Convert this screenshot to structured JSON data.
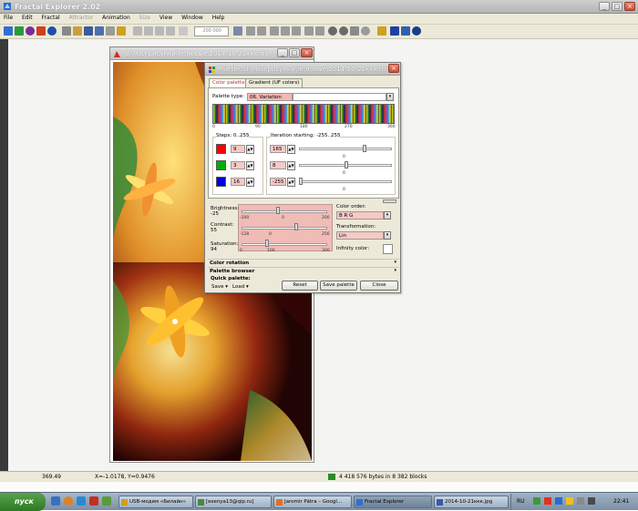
{
  "app": {
    "title": "Fractal Explorer 2.02"
  },
  "menu": [
    "File",
    "Edit",
    "Fractal",
    "Attractor",
    "Animation",
    "Size",
    "View",
    "Window",
    "Help"
  ],
  "toolbar": {
    "zoom_value": "200 000"
  },
  "fractal_window": {
    "title": "d:\\мои рисунки\\fe\\новые\\2014-10-21ккк.frs"
  },
  "palette_dialog": {
    "title": "Palette: d:\\мои рисунки\\fe\\новые\\2014-10-21ккк.frs",
    "tabs": [
      "Color palette",
      "Gradient (UF colors)"
    ],
    "palette_type_label": "Palette type:",
    "palette_type_value": "06. Variation",
    "bar_ticks": [
      "0",
      "90",
      "180",
      "270",
      "360"
    ],
    "steps_label": "Steps: 0..255",
    "iteration_label": "Iteration starting: -255..255",
    "rows": [
      {
        "color": "#ff0000",
        "steps": "9",
        "iter": "165",
        "center": "0"
      },
      {
        "color": "#00b000",
        "steps": "3",
        "iter": "8",
        "center": "0"
      },
      {
        "color": "#0000e0",
        "steps": "16",
        "iter": "-255",
        "center": "0"
      }
    ],
    "brightness": {
      "label": "Brightness:",
      "value": "-25",
      "ticks": [
        "-200",
        "0",
        "200"
      ]
    },
    "contrast": {
      "label": "Contrast:",
      "value": "55",
      "ticks": [
        "-128",
        "0",
        "256"
      ]
    },
    "saturation": {
      "label": "Saturation:",
      "value": "94",
      "ticks": [
        "0",
        "100",
        "300"
      ]
    },
    "color_order": {
      "label": "Color order:",
      "value": "B R G"
    },
    "transformation": {
      "label": "Transformation:",
      "value": "Lin"
    },
    "infinity_label": "Infinity color:",
    "color_rotation": "Color rotation",
    "palette_browser": "Palette browser",
    "quick_palette": "Quick palette:",
    "save_label": "Save",
    "load_label": "Load",
    "buttons": {
      "reset": "Reset",
      "save_palette": "Save palette",
      "close": "Close"
    }
  },
  "status": {
    "left": "369.49",
    "coords": "X=-1.0178, Y=0.9476",
    "memory": "4 418 576 bytes in 8 382 blocks"
  },
  "taskbar": {
    "start": "пуск",
    "tasks": [
      "USB-модем «Билайн»",
      "[esenya13@qip.ru]",
      "Jaromir Pátra – Googl...",
      "Fractal Explorer",
      "2014-10-21ккк.jpg"
    ],
    "lang": "RU",
    "clock": "22:41"
  },
  "colors": {
    "accent_pink": "#f7c9c4",
    "titlebar": "#c2c2c2",
    "dialog_bg": "#ece9d8"
  }
}
